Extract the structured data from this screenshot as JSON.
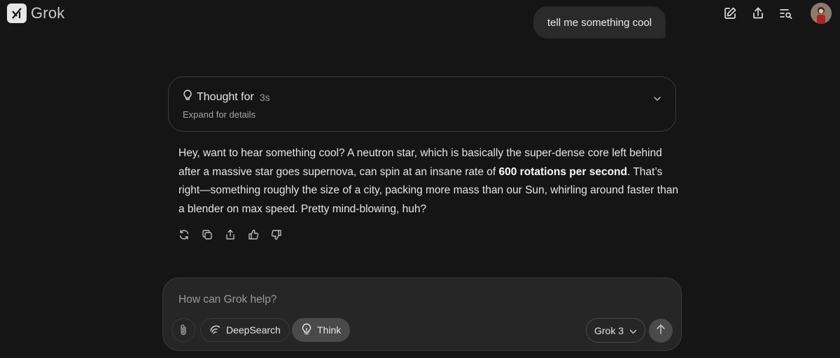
{
  "header": {
    "app_name": "Grok",
    "actions": [
      "new-chat-icon",
      "share-icon",
      "history-search-icon"
    ]
  },
  "conversation": {
    "user_message": "tell me something cool",
    "thought": {
      "label": "Thought for",
      "duration": "3s",
      "subtitle": "Expand for details"
    },
    "answer": {
      "part1": "Hey, want to hear something cool? A neutron star, which is basically the super-dense core left behind after a massive star goes supernova, can spin at an insane rate of ",
      "bold": "600 rotations per second",
      "part2": ". That’s right—something roughly the size of a city, packing more mass than our Sun, whirling around faster than a blender on max speed. Pretty mind-blowing, huh?"
    },
    "message_actions": [
      "regenerate-icon",
      "copy-icon",
      "share-icon",
      "thumbs-up-icon",
      "thumbs-down-icon"
    ]
  },
  "composer": {
    "placeholder": "How can Grok help?",
    "deepsearch_label": "DeepSearch",
    "think_label": "Think",
    "model": "Grok 3"
  },
  "colors": {
    "background": "#151515",
    "bubble": "#2a2a2a",
    "composer": "#262626",
    "active_pill": "#4a4a4a"
  }
}
